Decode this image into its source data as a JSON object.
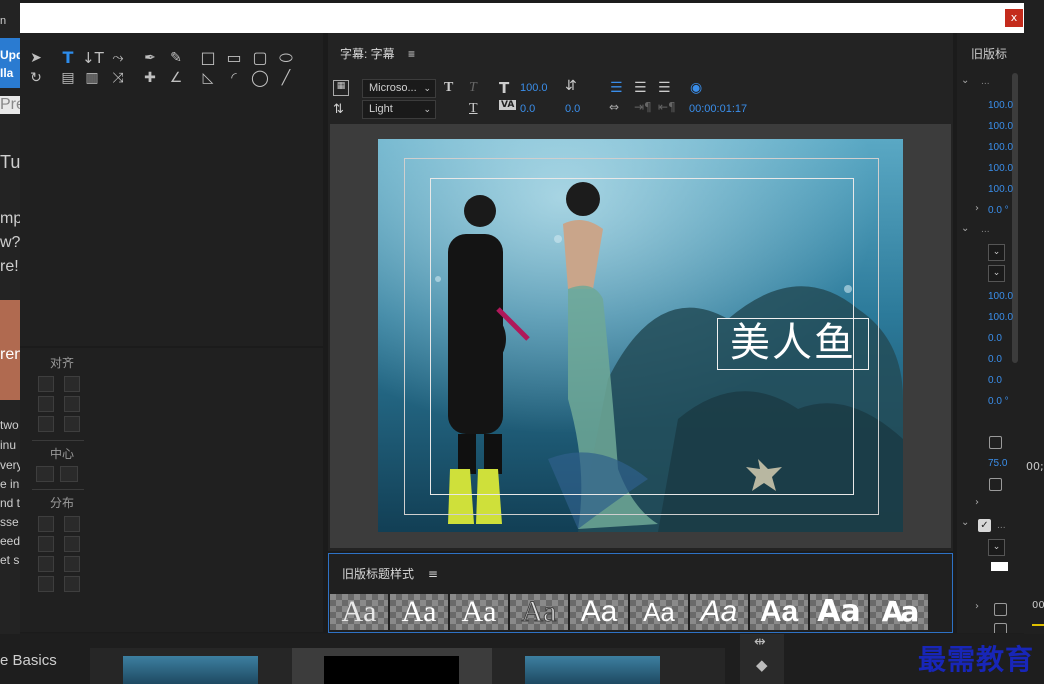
{
  "background_left": {
    "fragments": [
      "n",
      "Upda",
      "Ila",
      "Pre",
      "Tut",
      "mp",
      "w?",
      "re!",
      "ren",
      "two",
      "inu",
      "very",
      "e in",
      "nd t",
      "sse",
      "eed",
      "et sh"
    ],
    "basics_label": "e Basics"
  },
  "window": {
    "close_label": "x"
  },
  "align_panel": {
    "align_label": "对齐",
    "center_label": "中心",
    "distribute_label": "分布"
  },
  "title_panel": {
    "header": "字幕: 字幕",
    "menu_icon": "≡",
    "font_family": "Microso...",
    "font_style": "Light",
    "font_size": "100.0",
    "kerning": "0.0",
    "leading": "0.0",
    "tracking": "0.0",
    "timecode": "00:00:01:17",
    "caption_text": "美人鱼"
  },
  "styles_panel": {
    "header": "旧版标题样式",
    "menu_icon": "≡",
    "swatches": [
      "Aa",
      "Aa",
      "Aa",
      "Aa",
      "Aa",
      "Aa",
      "Aa",
      "Aa",
      "Aa",
      "Aa"
    ]
  },
  "properties_panel": {
    "header": "旧版标",
    "values": [
      "100.0",
      "100.0",
      "100.0",
      "100.0",
      "100.0",
      "0.0 °",
      "100.0",
      "100.0",
      "0.0",
      "0.0",
      "0.0",
      "0.0 °",
      "75.0"
    ]
  },
  "right_edge": {
    "fragments": [
      "00;",
      "00:"
    ]
  },
  "watermark": {
    "text": "最需教育"
  },
  "colors": {
    "accent": "#2d8ceb",
    "close": "#c42b1c",
    "panel_border": "#2e72c5",
    "logo": "#1826b8"
  }
}
